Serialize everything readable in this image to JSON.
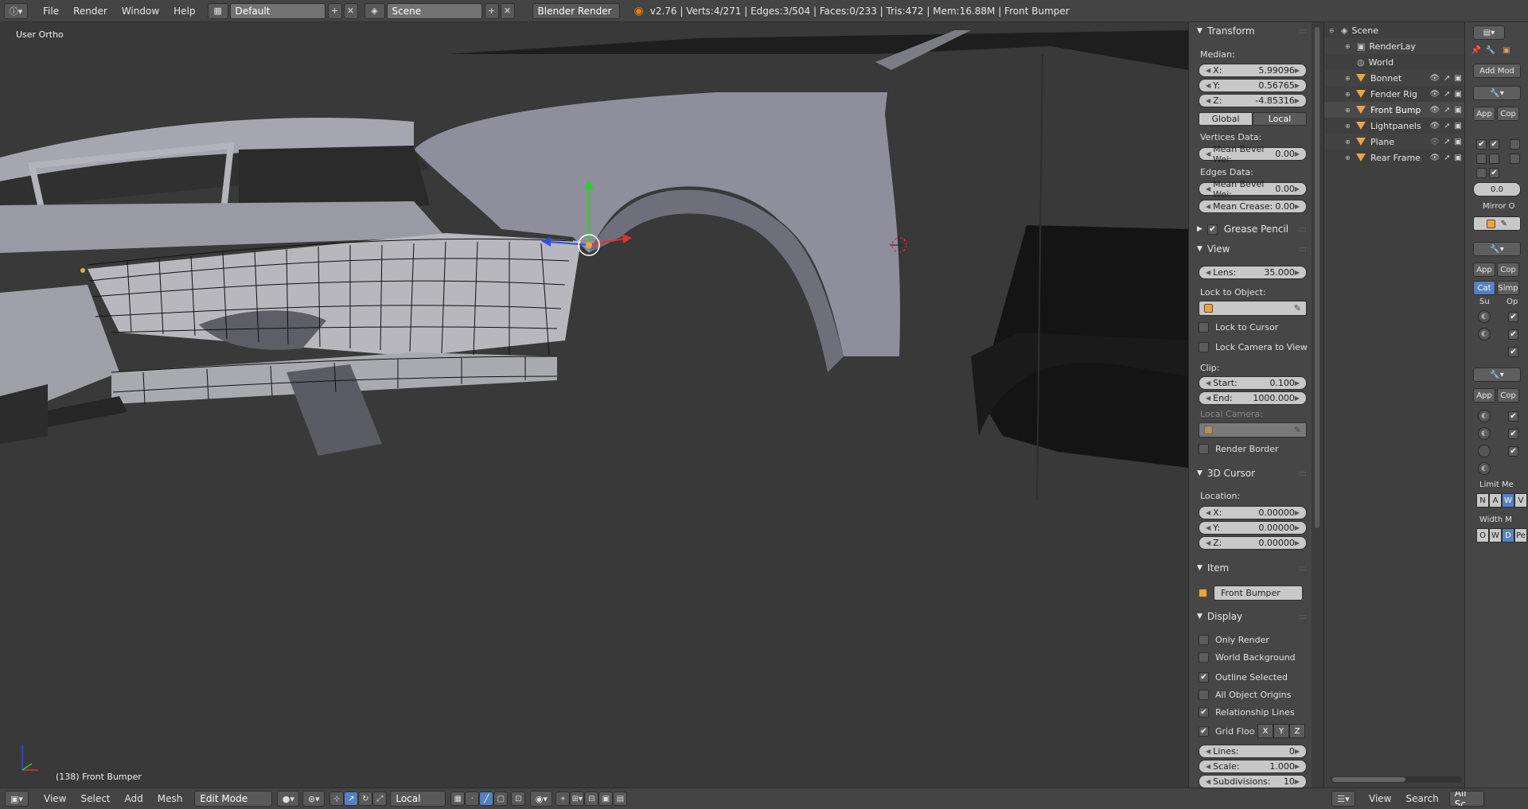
{
  "top_header": {
    "menus": [
      "File",
      "Render",
      "Window",
      "Help"
    ],
    "screen_layout": "Default",
    "scene": "Scene",
    "render_engine": "Blender Render",
    "info": "v2.76 | Verts:4/271 | Edges:3/504 | Faces:0/233 | Tris:472 | Mem:16.88M | Front Bumper"
  },
  "viewport": {
    "view_name": "User Ortho",
    "object_label": "(138) Front Bumper"
  },
  "npanel": {
    "transform": {
      "title": "Transform",
      "median_label": "Median:",
      "x_name": "X:",
      "x": "5.99096",
      "y_name": "Y:",
      "y": "0.56765",
      "z_name": "Z:",
      "z": "-4.85316",
      "global": "Global",
      "local": "Local",
      "vertices_data": "Vertices Data:",
      "v_bevel_name": "Mean Bevel Wei:",
      "v_bevel": "0.00",
      "edges_data": "Edges Data:",
      "e_bevel_name": "Mean Bevel Wei:",
      "e_bevel": "0.00",
      "crease_name": "Mean Crease:",
      "crease": "0.00"
    },
    "grease_pencil": "Grease Pencil",
    "view": {
      "title": "View",
      "lens_name": "Lens:",
      "lens": "35.000",
      "lock_to_object": "Lock to Object:",
      "lock_to_cursor": "Lock to Cursor",
      "lock_camera": "Lock Camera to View",
      "clip": "Clip:",
      "start_name": "Start:",
      "start": "0.100",
      "end_name": "End:",
      "end": "1000.000",
      "local_camera": "Local Camera:",
      "render_border": "Render Border"
    },
    "cursor": {
      "title": "3D Cursor",
      "location": "Location:",
      "x_name": "X:",
      "x": "0.00000",
      "y_name": "Y:",
      "y": "0.00000",
      "z_name": "Z:",
      "z": "0.00000"
    },
    "item": {
      "title": "Item",
      "name": "Front Bumper"
    },
    "display": {
      "title": "Display",
      "only_render": "Only Render",
      "world_background": "World Background",
      "outline_selected": "Outline Selected",
      "all_object_origins": "All Object Origins",
      "relationship_lines": "Relationship Lines",
      "grid_floor": "Grid Floo",
      "axis_x": "X",
      "axis_y": "Y",
      "axis_z": "Z",
      "lines_name": "Lines:",
      "lines": "0",
      "scale_name": "Scale:",
      "scale": "1.000",
      "subdiv_name": "Subdivisions:",
      "subdiv": "10"
    }
  },
  "outliner": {
    "items": [
      {
        "label": "Scene"
      },
      {
        "label": "RenderLay"
      },
      {
        "label": "World"
      },
      {
        "label": "Bonnet"
      },
      {
        "label": "Fender Rig"
      },
      {
        "label": "Front Bump"
      },
      {
        "label": "Lightpanels"
      },
      {
        "label": "Plane"
      },
      {
        "label": "Rear Frame"
      }
    ],
    "footer": {
      "view": "View",
      "search": "Search",
      "filter": "All Sc"
    }
  },
  "properties": {
    "add_modifier": "Add Mod",
    "apply": "App",
    "copy": "Cop",
    "value": "0.0",
    "mirror": "Mirror O",
    "cat": "Cat",
    "simp": "Simp",
    "su": "Su",
    "op": "Op",
    "limit_method": "Limit Me",
    "limit_opts": [
      "N",
      "A",
      "W",
      "V"
    ],
    "width_method": "Width M",
    "width_opts": [
      "O",
      "W",
      "D",
      "Pe"
    ]
  },
  "bottom_header": {
    "menus": [
      "View",
      "Select",
      "Add",
      "Mesh"
    ],
    "mode": "Edit Mode",
    "orientation": "Local"
  },
  "colors": {
    "accent": "#5680c2",
    "object_orange": "#e8a44a",
    "viewport_bg": "#393939"
  }
}
